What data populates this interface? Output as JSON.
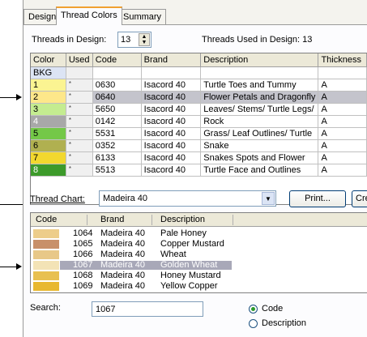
{
  "tabs": [
    {
      "label": "Design"
    },
    {
      "label": "Thread Colors"
    },
    {
      "label": "Summary"
    }
  ],
  "threads_in_design": {
    "label": "Threads in Design:",
    "value": "13"
  },
  "threads_used": {
    "label": "Threads Used in Design: 13"
  },
  "design_table": {
    "columns": [
      "Color",
      "Used",
      "Code",
      "Brand",
      "Description",
      "Thickness"
    ],
    "rows": [
      {
        "color_label": "BKG",
        "swatch": "#ffffff",
        "used": "",
        "code": "",
        "brand": "",
        "description": "",
        "thickness": "",
        "selected": false
      },
      {
        "color_label": "1",
        "swatch": "#fbf492",
        "used": "*",
        "code": "0630",
        "brand": "Isacord 40",
        "description": "Turtle Toes and Tummy",
        "thickness": "A",
        "selected": false
      },
      {
        "color_label": "2",
        "swatch": "#fde78a",
        "used": "*",
        "code": "0640",
        "brand": "Isacord 40",
        "description": "Flower Petals and Dragonfly",
        "thickness": "A",
        "selected": true
      },
      {
        "color_label": "3",
        "swatch": "#c4ec90",
        "used": "*",
        "code": "5650",
        "brand": "Isacord 40",
        "description": "Leaves/ Stems/ Turtle Legs/",
        "thickness": "A",
        "selected": false
      },
      {
        "color_label": "4",
        "swatch": "#a8a8a8",
        "used": "*",
        "code": "0142",
        "brand": "Isacord 40",
        "description": "Rock",
        "thickness": "A",
        "selected": false
      },
      {
        "color_label": "5",
        "swatch": "#74c848",
        "used": "*",
        "code": "5531",
        "brand": "Isacord 40",
        "description": "Grass/ Leaf Outlines/ Turtle",
        "thickness": "A",
        "selected": false
      },
      {
        "color_label": "6",
        "swatch": "#b0b050",
        "used": "*",
        "code": "0352",
        "brand": "Isacord 40",
        "description": "Snake",
        "thickness": "A",
        "selected": false
      },
      {
        "color_label": "7",
        "swatch": "#f2d82e",
        "used": "*",
        "code": "6133",
        "brand": "Isacord 40",
        "description": "Snakes Spots and Flower",
        "thickness": "A",
        "selected": false
      },
      {
        "color_label": "8",
        "swatch": "#3c9a2a",
        "used": "*",
        "code": "5513",
        "brand": "Isacord 40",
        "description": "Turtle Face and Outlines",
        "thickness": "A",
        "selected": false
      }
    ]
  },
  "thread_chart": {
    "label": "Thread Chart:",
    "value": "Madeira 40"
  },
  "buttons": {
    "print": "Print...",
    "create": "Create/Mo"
  },
  "chart_list": {
    "columns": [
      "Code",
      "Brand",
      "Description"
    ],
    "rows": [
      {
        "swatch": "#edcd8a",
        "code": "1064",
        "brand": "Madeira 40",
        "description": "Pale Honey",
        "selected": false
      },
      {
        "swatch": "#c8906a",
        "code": "1065",
        "brand": "Madeira 40",
        "description": "Copper Mustard",
        "selected": false
      },
      {
        "swatch": "#e8c888",
        "code": "1066",
        "brand": "Madeira 40",
        "description": "Wheat",
        "selected": false
      },
      {
        "swatch": "#f3e3b6",
        "code": "1067",
        "brand": "Madeira 40",
        "description": "Golden Wheat",
        "selected": true
      },
      {
        "swatch": "#e8c050",
        "code": "1068",
        "brand": "Madeira 40",
        "description": "Honey Mustard",
        "selected": false
      },
      {
        "swatch": "#e8b830",
        "code": "1069",
        "brand": "Madeira 40",
        "description": "Yellow Copper",
        "selected": false
      }
    ]
  },
  "search": {
    "label": "Search:",
    "value": "1067"
  },
  "radios": [
    {
      "label": "Code",
      "checked": true
    },
    {
      "label": "Description",
      "checked": false
    }
  ]
}
